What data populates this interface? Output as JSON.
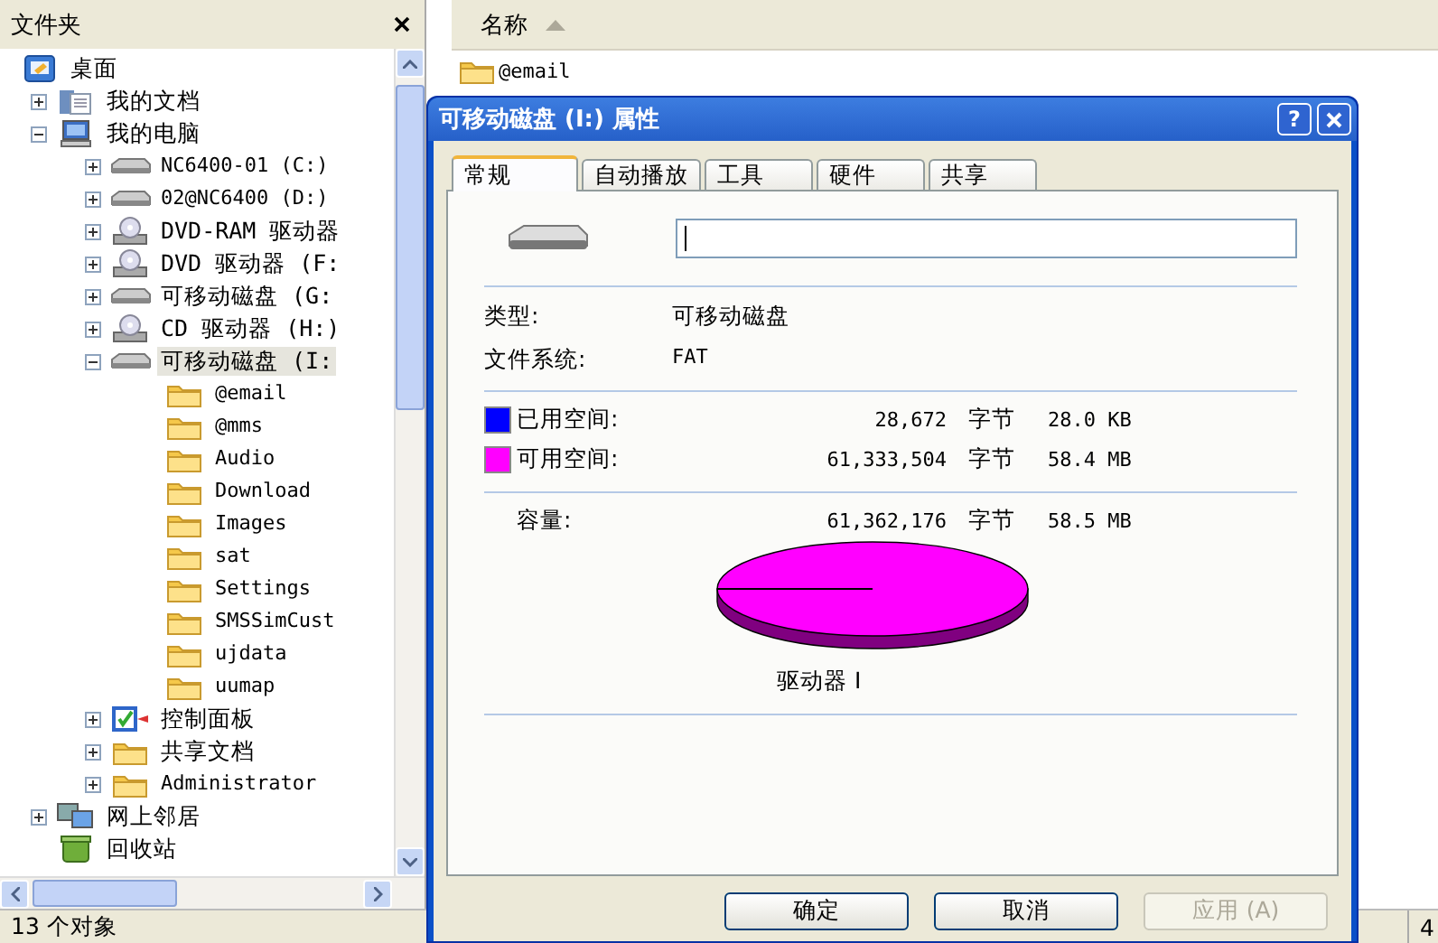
{
  "folder_pane": {
    "title": "文件夹"
  },
  "tree": [
    {
      "label": "桌面",
      "kind": "desktop",
      "selected": false,
      "children": [
        {
          "label": "我的文档",
          "kind": "documents",
          "expanded": false,
          "selected": false
        },
        {
          "label": "我的电脑",
          "kind": "computer",
          "expanded": true,
          "selected": false,
          "children": [
            {
              "label": "NC6400-01 (C:)",
              "kind": "drive",
              "expanded": false,
              "selected": false
            },
            {
              "label": "02@NC6400 (D:)",
              "kind": "drive",
              "expanded": false,
              "selected": false
            },
            {
              "label": "DVD-RAM 驱动器",
              "kind": "cd",
              "expanded": false,
              "selected": false
            },
            {
              "label": "DVD 驱动器 (F:",
              "kind": "cd",
              "expanded": false,
              "selected": false
            },
            {
              "label": "可移动磁盘 (G:",
              "kind": "drive",
              "expanded": false,
              "selected": false
            },
            {
              "label": "CD 驱动器 (H:)",
              "kind": "cd",
              "expanded": false,
              "selected": false
            },
            {
              "label": "可移动磁盘 (I:",
              "kind": "drive",
              "expanded": true,
              "selected": true,
              "children": [
                {
                  "label": "@email",
                  "kind": "folder",
                  "selected": false
                },
                {
                  "label": "@mms",
                  "kind": "folder",
                  "selected": false
                },
                {
                  "label": "Audio",
                  "kind": "folder",
                  "selected": false
                },
                {
                  "label": "Download",
                  "kind": "folder",
                  "selected": false
                },
                {
                  "label": "Images",
                  "kind": "folder",
                  "selected": false
                },
                {
                  "label": "sat",
                  "kind": "folder",
                  "selected": false
                },
                {
                  "label": "Settings",
                  "kind": "folder",
                  "selected": false
                },
                {
                  "label": "SMSSimCust",
                  "kind": "folder",
                  "selected": false
                },
                {
                  "label": "ujdata",
                  "kind": "folder",
                  "selected": false
                },
                {
                  "label": "uumap",
                  "kind": "folder",
                  "selected": false
                }
              ]
            },
            {
              "label": "控制面板",
              "kind": "control-panel",
              "expanded": false,
              "selected": false
            },
            {
              "label": "共享文档",
              "kind": "folder",
              "expanded": false,
              "selected": false
            },
            {
              "label": "Administrator",
              "kind": "folder",
              "expanded": false,
              "selected": false
            }
          ]
        },
        {
          "label": "网上邻居",
          "kind": "network",
          "expanded": false,
          "selected": false
        },
        {
          "label": "回收站",
          "kind": "recycle",
          "selected": false
        }
      ]
    }
  ],
  "file_list": {
    "columns": [
      {
        "label": "名称",
        "sorted": true
      }
    ],
    "items": [
      {
        "name": "@email"
      }
    ]
  },
  "status_bar": {
    "text": "13 个对象",
    "column_2": "4"
  },
  "dialog": {
    "title": "可移动磁盘 (I:) 属性",
    "help_button": "?",
    "tabs": [
      {
        "label": "常规",
        "selected": true
      },
      {
        "label": "自动播放",
        "selected": false
      },
      {
        "label": "工具",
        "selected": false
      },
      {
        "label": "硬件",
        "selected": false
      },
      {
        "label": "共享",
        "selected": false
      }
    ],
    "info": [
      {
        "label": "类型:",
        "value": "可移动磁盘"
      },
      {
        "label": "文件系统:",
        "value": "FAT"
      }
    ],
    "space": [
      {
        "label": "已用空间:",
        "color": "#0000ff",
        "bytes": "28,672",
        "unit": "字节",
        "size": "28.0 KB"
      },
      {
        "label": "可用空间:",
        "color": "#ff00ff",
        "bytes": "61,333,504",
        "unit": "字节",
        "size": "58.4 MB"
      }
    ],
    "capacity": {
      "label": "容量:",
      "bytes": "61,362,176",
      "unit": "字节",
      "size": "58.5 MB"
    },
    "drive_label": "驱动器 I",
    "buttons": [
      {
        "label": "确定",
        "disabled": false
      },
      {
        "label": "取消",
        "disabled": false
      },
      {
        "label": "应用 (A)",
        "disabled": true
      }
    ]
  }
}
